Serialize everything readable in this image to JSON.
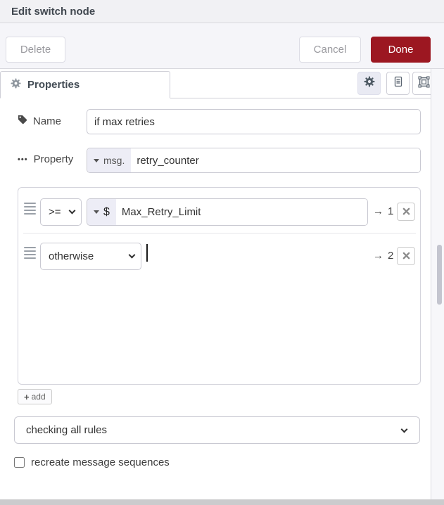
{
  "header": {
    "title": "Edit switch node"
  },
  "toolbar": {
    "delete_label": "Delete",
    "cancel_label": "Cancel",
    "done_label": "Done"
  },
  "tabs": {
    "properties_label": "Properties"
  },
  "form": {
    "name": {
      "label": "Name",
      "value": "if max retries"
    },
    "property": {
      "label": "Property",
      "type_label": "msg.",
      "value": "retry_counter"
    },
    "rules": [
      {
        "operator": ">=",
        "value_type": "$",
        "value": "Max_Retry_Limit",
        "arrow": "→",
        "output": "1"
      },
      {
        "operator": "otherwise",
        "arrow": "→",
        "output": "2"
      }
    ],
    "add_label": "add",
    "mode": {
      "selected": "checking all rules"
    },
    "recreate": {
      "label": "recreate message sequences",
      "checked": false
    }
  },
  "icons": {
    "ellipsis": "•••",
    "plus": "+"
  },
  "colors": {
    "done_button_bg": "#9c1721",
    "typed_input_bg": "#ededf6",
    "active_icon_button_bg": "#e9eaf3",
    "header_bg": "#f1f1f4",
    "button_bar_bg": "#f5f5f9"
  }
}
